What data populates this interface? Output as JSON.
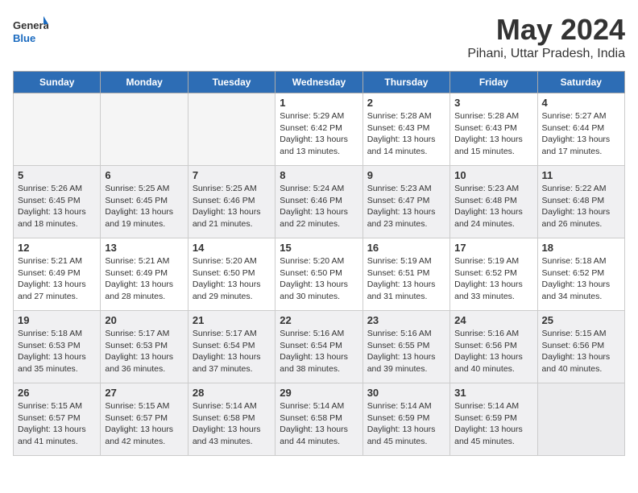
{
  "header": {
    "logo_general": "General",
    "logo_blue": "Blue",
    "month": "May 2024",
    "location": "Pihani, Uttar Pradesh, India"
  },
  "days_of_week": [
    "Sunday",
    "Monday",
    "Tuesday",
    "Wednesday",
    "Thursday",
    "Friday",
    "Saturday"
  ],
  "weeks": [
    [
      {
        "day": null
      },
      {
        "day": null
      },
      {
        "day": null
      },
      {
        "day": "1",
        "sunrise": "Sunrise: 5:29 AM",
        "sunset": "Sunset: 6:42 PM",
        "daylight": "Daylight: 13 hours and 13 minutes."
      },
      {
        "day": "2",
        "sunrise": "Sunrise: 5:28 AM",
        "sunset": "Sunset: 6:43 PM",
        "daylight": "Daylight: 13 hours and 14 minutes."
      },
      {
        "day": "3",
        "sunrise": "Sunrise: 5:28 AM",
        "sunset": "Sunset: 6:43 PM",
        "daylight": "Daylight: 13 hours and 15 minutes."
      },
      {
        "day": "4",
        "sunrise": "Sunrise: 5:27 AM",
        "sunset": "Sunset: 6:44 PM",
        "daylight": "Daylight: 13 hours and 17 minutes."
      }
    ],
    [
      {
        "day": "5",
        "sunrise": "Sunrise: 5:26 AM",
        "sunset": "Sunset: 6:45 PM",
        "daylight": "Daylight: 13 hours and 18 minutes."
      },
      {
        "day": "6",
        "sunrise": "Sunrise: 5:25 AM",
        "sunset": "Sunset: 6:45 PM",
        "daylight": "Daylight: 13 hours and 19 minutes."
      },
      {
        "day": "7",
        "sunrise": "Sunrise: 5:25 AM",
        "sunset": "Sunset: 6:46 PM",
        "daylight": "Daylight: 13 hours and 21 minutes."
      },
      {
        "day": "8",
        "sunrise": "Sunrise: 5:24 AM",
        "sunset": "Sunset: 6:46 PM",
        "daylight": "Daylight: 13 hours and 22 minutes."
      },
      {
        "day": "9",
        "sunrise": "Sunrise: 5:23 AM",
        "sunset": "Sunset: 6:47 PM",
        "daylight": "Daylight: 13 hours and 23 minutes."
      },
      {
        "day": "10",
        "sunrise": "Sunrise: 5:23 AM",
        "sunset": "Sunset: 6:48 PM",
        "daylight": "Daylight: 13 hours and 24 minutes."
      },
      {
        "day": "11",
        "sunrise": "Sunrise: 5:22 AM",
        "sunset": "Sunset: 6:48 PM",
        "daylight": "Daylight: 13 hours and 26 minutes."
      }
    ],
    [
      {
        "day": "12",
        "sunrise": "Sunrise: 5:21 AM",
        "sunset": "Sunset: 6:49 PM",
        "daylight": "Daylight: 13 hours and 27 minutes."
      },
      {
        "day": "13",
        "sunrise": "Sunrise: 5:21 AM",
        "sunset": "Sunset: 6:49 PM",
        "daylight": "Daylight: 13 hours and 28 minutes."
      },
      {
        "day": "14",
        "sunrise": "Sunrise: 5:20 AM",
        "sunset": "Sunset: 6:50 PM",
        "daylight": "Daylight: 13 hours and 29 minutes."
      },
      {
        "day": "15",
        "sunrise": "Sunrise: 5:20 AM",
        "sunset": "Sunset: 6:50 PM",
        "daylight": "Daylight: 13 hours and 30 minutes."
      },
      {
        "day": "16",
        "sunrise": "Sunrise: 5:19 AM",
        "sunset": "Sunset: 6:51 PM",
        "daylight": "Daylight: 13 hours and 31 minutes."
      },
      {
        "day": "17",
        "sunrise": "Sunrise: 5:19 AM",
        "sunset": "Sunset: 6:52 PM",
        "daylight": "Daylight: 13 hours and 33 minutes."
      },
      {
        "day": "18",
        "sunrise": "Sunrise: 5:18 AM",
        "sunset": "Sunset: 6:52 PM",
        "daylight": "Daylight: 13 hours and 34 minutes."
      }
    ],
    [
      {
        "day": "19",
        "sunrise": "Sunrise: 5:18 AM",
        "sunset": "Sunset: 6:53 PM",
        "daylight": "Daylight: 13 hours and 35 minutes."
      },
      {
        "day": "20",
        "sunrise": "Sunrise: 5:17 AM",
        "sunset": "Sunset: 6:53 PM",
        "daylight": "Daylight: 13 hours and 36 minutes."
      },
      {
        "day": "21",
        "sunrise": "Sunrise: 5:17 AM",
        "sunset": "Sunset: 6:54 PM",
        "daylight": "Daylight: 13 hours and 37 minutes."
      },
      {
        "day": "22",
        "sunrise": "Sunrise: 5:16 AM",
        "sunset": "Sunset: 6:54 PM",
        "daylight": "Daylight: 13 hours and 38 minutes."
      },
      {
        "day": "23",
        "sunrise": "Sunrise: 5:16 AM",
        "sunset": "Sunset: 6:55 PM",
        "daylight": "Daylight: 13 hours and 39 minutes."
      },
      {
        "day": "24",
        "sunrise": "Sunrise: 5:16 AM",
        "sunset": "Sunset: 6:56 PM",
        "daylight": "Daylight: 13 hours and 40 minutes."
      },
      {
        "day": "25",
        "sunrise": "Sunrise: 5:15 AM",
        "sunset": "Sunset: 6:56 PM",
        "daylight": "Daylight: 13 hours and 40 minutes."
      }
    ],
    [
      {
        "day": "26",
        "sunrise": "Sunrise: 5:15 AM",
        "sunset": "Sunset: 6:57 PM",
        "daylight": "Daylight: 13 hours and 41 minutes."
      },
      {
        "day": "27",
        "sunrise": "Sunrise: 5:15 AM",
        "sunset": "Sunset: 6:57 PM",
        "daylight": "Daylight: 13 hours and 42 minutes."
      },
      {
        "day": "28",
        "sunrise": "Sunrise: 5:14 AM",
        "sunset": "Sunset: 6:58 PM",
        "daylight": "Daylight: 13 hours and 43 minutes."
      },
      {
        "day": "29",
        "sunrise": "Sunrise: 5:14 AM",
        "sunset": "Sunset: 6:58 PM",
        "daylight": "Daylight: 13 hours and 44 minutes."
      },
      {
        "day": "30",
        "sunrise": "Sunrise: 5:14 AM",
        "sunset": "Sunset: 6:59 PM",
        "daylight": "Daylight: 13 hours and 45 minutes."
      },
      {
        "day": "31",
        "sunrise": "Sunrise: 5:14 AM",
        "sunset": "Sunset: 6:59 PM",
        "daylight": "Daylight: 13 hours and 45 minutes."
      },
      {
        "day": null
      }
    ]
  ],
  "row_shading": [
    "light",
    "dark",
    "light",
    "dark",
    "light"
  ]
}
